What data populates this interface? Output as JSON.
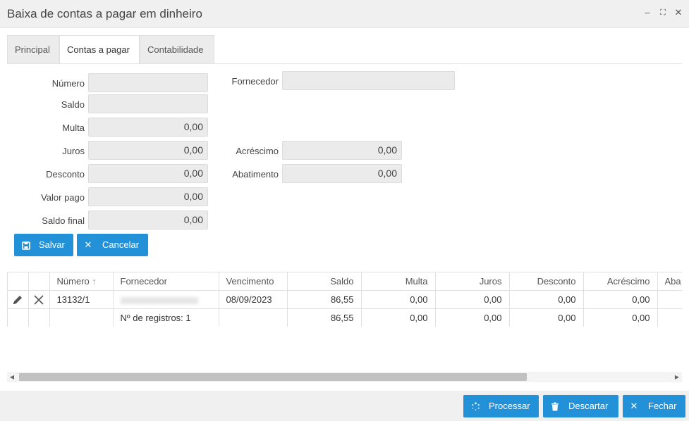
{
  "window": {
    "title": "Baixa de contas a pagar em dinheiro",
    "minimize_glyph": "–",
    "maximize_glyph": "⛶",
    "close_glyph": "✕"
  },
  "tabs": [
    {
      "label": "Principal",
      "active": false
    },
    {
      "label": "Contas a pagar",
      "active": true
    },
    {
      "label": "Contabilidade",
      "active": false
    }
  ],
  "form": {
    "numero": {
      "label": "Número",
      "value": ""
    },
    "fornecedor": {
      "label": "Fornecedor",
      "value": ""
    },
    "saldo": {
      "label": "Saldo",
      "value": ""
    },
    "multa": {
      "label": "Multa",
      "value": "0,00"
    },
    "juros": {
      "label": "Juros",
      "value": "0,00"
    },
    "acrescimo": {
      "label": "Acréscimo",
      "value": "0,00"
    },
    "desconto": {
      "label": "Desconto",
      "value": "0,00"
    },
    "abatimento": {
      "label": "Abatimento",
      "value": "0,00"
    },
    "valor_pago": {
      "label": "Valor pago",
      "value": "0,00"
    },
    "saldo_final": {
      "label": "Saldo final",
      "value": "0,00"
    }
  },
  "actions": {
    "salvar": "Salvar",
    "cancelar": "Cancelar"
  },
  "grid": {
    "columns": [
      "Número",
      "Fornecedor",
      "Vencimento",
      "Saldo",
      "Multa",
      "Juros",
      "Desconto",
      "Acréscimo",
      "Aba"
    ],
    "sort_glyph": "↑",
    "rows": [
      {
        "numero": "13132/1",
        "fornecedor": "",
        "vencimento": "08/09/2023",
        "saldo": "86,55",
        "multa": "0,00",
        "juros": "0,00",
        "desconto": "0,00",
        "acrescimo": "0,00"
      }
    ],
    "footer": {
      "registros": "Nº de registros: 1",
      "saldo": "86,55",
      "multa": "0,00",
      "juros": "0,00",
      "desconto": "0,00",
      "acrescimo": "0,00"
    }
  },
  "bottom_buttons": {
    "processar": "Processar",
    "descartar": "Descartar",
    "fechar": "Fechar"
  },
  "colors": {
    "accent": "#2391d8",
    "titlebar": "#f0f0f0",
    "field_bg": "#ebebeb"
  }
}
